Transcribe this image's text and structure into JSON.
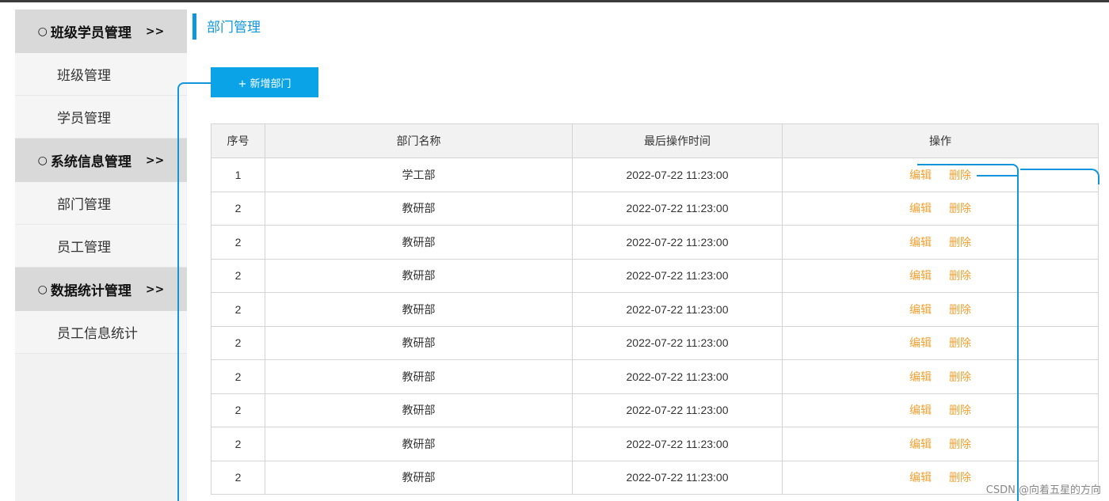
{
  "sidebar": {
    "groups": [
      {
        "label": "班级学员管理",
        "arrows": ">>",
        "items": [
          "班级管理",
          "学员管理"
        ]
      },
      {
        "label": "系统信息管理",
        "arrows": ">>",
        "items": [
          "部门管理",
          "员工管理"
        ]
      },
      {
        "label": "数据统计管理",
        "arrows": ">>",
        "items": [
          "员工信息统计"
        ]
      }
    ],
    "circle_glyph": "○"
  },
  "main": {
    "title": "部门管理",
    "add_button_label": "+ 新增部门",
    "table": {
      "headers": [
        "序号",
        "部门名称",
        "最后操作时间",
        "操作"
      ],
      "edit_label": "编辑",
      "delete_label": "删除",
      "rows": [
        [
          "1",
          "学工部",
          "2022-07-22 11:23:00"
        ],
        [
          "2",
          "教研部",
          "2022-07-22 11:23:00"
        ],
        [
          "2",
          "教研部",
          "2022-07-22 11:23:00"
        ],
        [
          "2",
          "教研部",
          "2022-07-22 11:23:00"
        ],
        [
          "2",
          "教研部",
          "2022-07-22 11:23:00"
        ],
        [
          "2",
          "教研部",
          "2022-07-22 11:23:00"
        ],
        [
          "2",
          "教研部",
          "2022-07-22 11:23:00"
        ],
        [
          "2",
          "教研部",
          "2022-07-22 11:23:00"
        ],
        [
          "2",
          "教研部",
          "2022-07-22 11:23:00"
        ],
        [
          "2",
          "教研部",
          "2022-07-22 11:23:00"
        ]
      ]
    }
  },
  "watermark": "CSDN @向着五星的方向",
  "colors": {
    "accent": "#1296db",
    "button": "#0aa3e8",
    "action_link": "#f0a030"
  }
}
